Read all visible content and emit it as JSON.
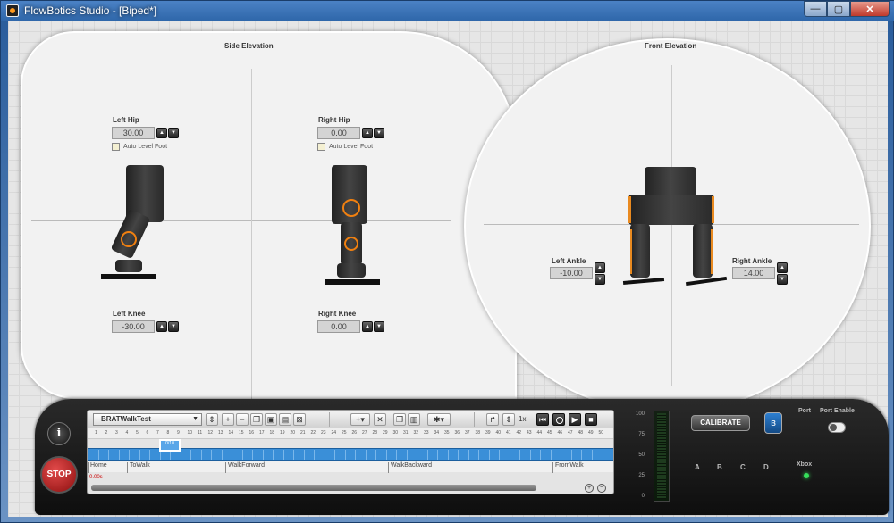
{
  "window": {
    "title": "FlowBotics Studio - [Biped*]",
    "minimize": "—",
    "maximize": "▢",
    "close": "✕"
  },
  "side_elevation": {
    "title": "Side Elevation",
    "left_hip": {
      "label": "Left Hip",
      "value": "30.00",
      "auto_level": "Auto Level Foot"
    },
    "right_hip": {
      "label": "Right Hip",
      "value": "0.00",
      "auto_level": "Auto Level Foot"
    },
    "left_knee": {
      "label": "Left Knee",
      "value": "-30.00"
    },
    "right_knee": {
      "label": "Right Knee",
      "value": "0.00"
    }
  },
  "front_elevation": {
    "title": "Front Elevation",
    "left_ankle": {
      "label": "Left Ankle",
      "value": "-10.00"
    },
    "right_ankle": {
      "label": "Right Ankle",
      "value": "14.00"
    }
  },
  "controls": {
    "info": "i",
    "stop": "STOP",
    "calibrate": "CALIBRATE",
    "bluetooth": "ʙ",
    "port": "Port",
    "port_enable": "Port Enable",
    "xbox": "Xbox",
    "letters": [
      "A",
      "B",
      "C",
      "D"
    ],
    "meter_scale": [
      "100",
      "75",
      "50",
      "25",
      "0"
    ]
  },
  "timeline": {
    "sequence": "BRATWalkTest",
    "speed": "1x",
    "playhead": "0/10",
    "timecode": "0.00s",
    "ticks": [
      "1",
      "2",
      "3",
      "4",
      "5",
      "6",
      "7",
      "8",
      "9",
      "10",
      "11",
      "12",
      "13",
      "14",
      "15",
      "16",
      "17",
      "18",
      "19",
      "20",
      "21",
      "22",
      "23",
      "24",
      "25",
      "26",
      "27",
      "28",
      "29",
      "30",
      "31",
      "32",
      "33",
      "34",
      "35",
      "36",
      "37",
      "38",
      "39",
      "40",
      "41",
      "42",
      "43",
      "44",
      "45",
      "46",
      "47",
      "48",
      "49",
      "50"
    ],
    "segments": [
      "Home",
      "ToWalk",
      "WalkForward",
      "WalkBackward",
      "FromWalk"
    ]
  },
  "colors": {
    "accent_orange": "#f08010",
    "track_blue": "#3a8fd8",
    "stop_red": "#c62828"
  }
}
